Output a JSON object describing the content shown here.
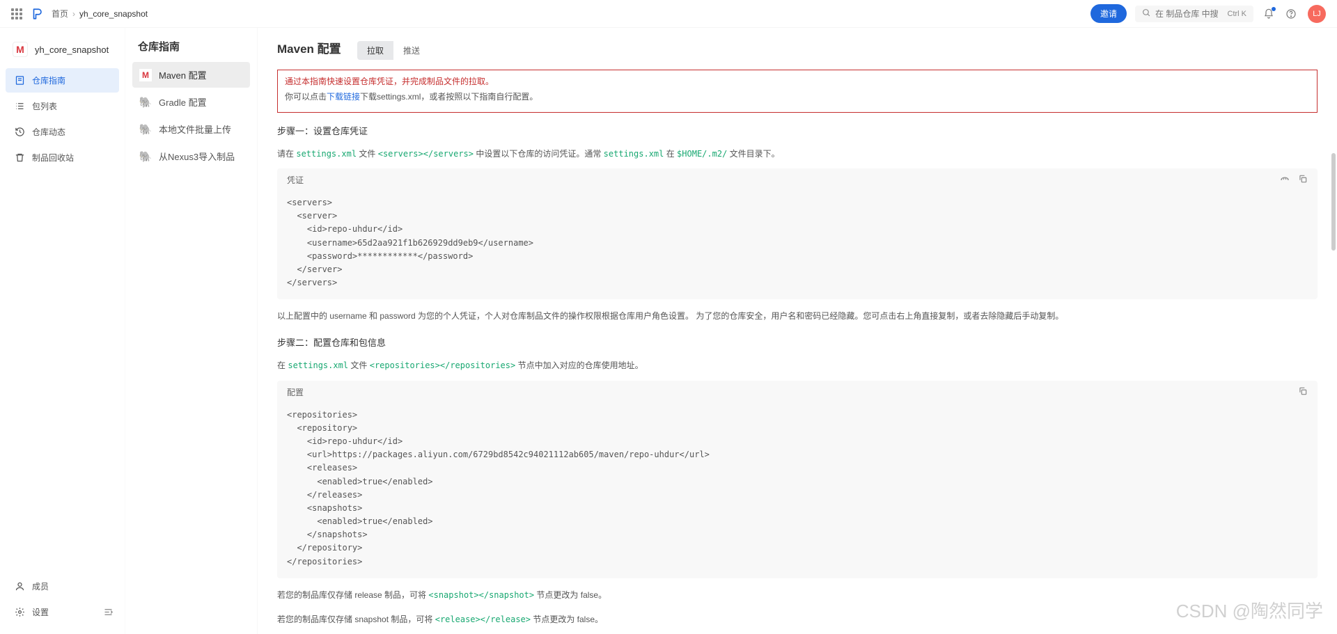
{
  "breadcrumbs": {
    "home": "首页",
    "current": "yh_core_snapshot"
  },
  "header": {
    "invite": "邀请",
    "search_placeholder": "在 制品仓库 中搜索",
    "kbd": "Ctrl K",
    "avatar": "LJ"
  },
  "leftnav": {
    "title": "yh_core_snapshot",
    "items": [
      "仓库指南",
      "包列表",
      "仓库动态",
      "制品回收站"
    ],
    "foot": [
      "成员",
      "设置"
    ]
  },
  "midnav": {
    "title": "仓库指南",
    "items": [
      "Maven 配置",
      "Gradle 配置",
      "本地文件批量上传",
      "从Nexus3导入制品"
    ]
  },
  "main": {
    "title": "Maven 配置",
    "tabs": [
      "拉取",
      "推送"
    ],
    "intro_red": "通过本指南快速设置仓库凭证，并完成制品文件的拉取。",
    "intro2a": "你可以点击",
    "intro2link": "下载链接",
    "intro2b": "下载settings.xml，或者按照以下指南自行配置。",
    "step1_title": "步骤一：设置仓库凭证",
    "step1_a": "请在 ",
    "step1_file": "settings.xml",
    "step1_b": " 文件 ",
    "step1_tag": "<servers></servers>",
    "step1_c": " 中设置以下仓库的访问凭证。通常 ",
    "step1_file2": "settings.xml",
    "step1_d": " 在 ",
    "step1_path": "$HOME/.m2/",
    "step1_e": " 文件目录下。",
    "code1_title": "凭证",
    "code1": "<servers>\n  <server>\n    <id>repo-uhdur</id>\n    <username>65d2aa921f1b626929dd9eb9</username>\n    <password>************</password>\n  </server>\n</servers>",
    "after1": "以上配置中的 username 和 password 为您的个人凭证，个人对仓库制品文件的操作权限根据仓库用户角色设置。 为了您的仓库安全，用户名和密码已经隐藏。您可点击右上角直接复制，或者去除隐藏后手动复制。",
    "step2_title": "步骤二：配置仓库和包信息",
    "step2_a": "在 ",
    "step2_file": "settings.xml",
    "step2_b": " 文件 ",
    "step2_tag": "<repositories></repositories>",
    "step2_c": " 节点中加入对应的仓库使用地址。",
    "code2_title": "配置",
    "code2": "<repositories>\n  <repository>\n    <id>repo-uhdur</id>\n    <url>https://packages.aliyun.com/6729bd8542c94021112ab605/maven/repo-uhdur</url>\n    <releases>\n      <enabled>true</enabled>\n    </releases>\n    <snapshots>\n      <enabled>true</enabled>\n    </snapshots>\n  </repository>\n</repositories>",
    "note1a": "若您的制品库仅存储 release 制品，可将 ",
    "note1tag": "<snapshot></snapshot>",
    "note1b": " 节点更改为 false。",
    "note2a": "若您的制品库仅存储 snapshot 制品，可将 ",
    "note2tag": "<release></release>",
    "note2b": " 节点更改为 false。"
  },
  "watermark": "CSDN @陶然同学"
}
